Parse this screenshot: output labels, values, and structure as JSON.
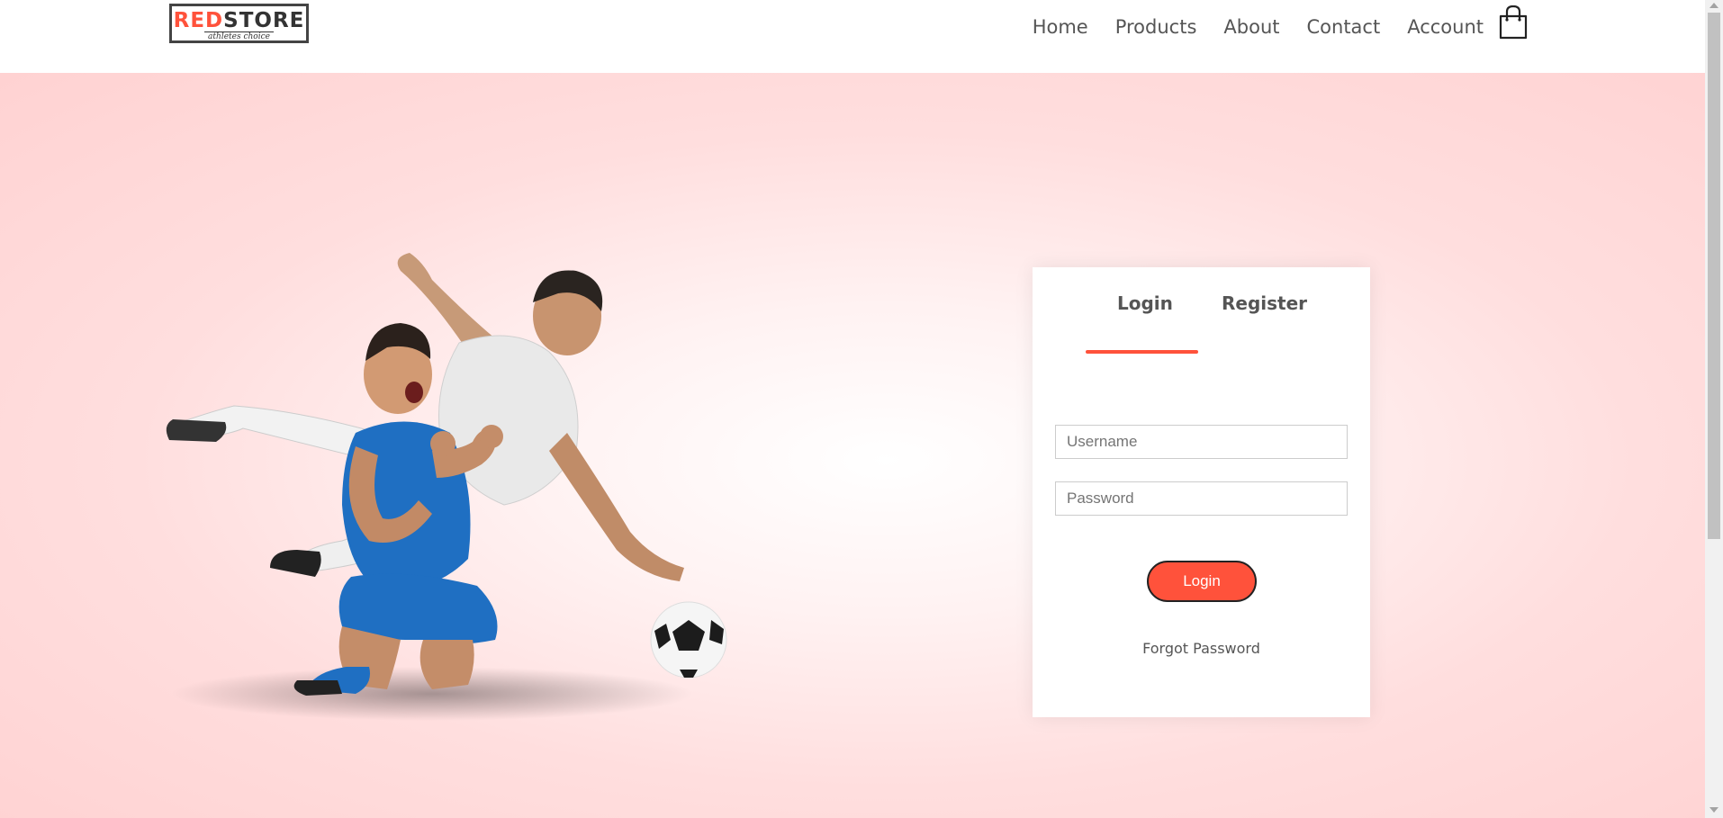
{
  "brand": {
    "logo_part1": "RED",
    "logo_part2": "STORE",
    "tagline": "athletes choice"
  },
  "nav": {
    "items": [
      {
        "label": "Home"
      },
      {
        "label": "Products"
      },
      {
        "label": "About"
      },
      {
        "label": "Contact"
      },
      {
        "label": "Account"
      }
    ],
    "cart_icon": "shopping-bag-icon"
  },
  "form": {
    "tabs": [
      {
        "label": "Login"
      },
      {
        "label": "Register"
      }
    ],
    "active_tab": "Login",
    "username": {
      "placeholder": "Username",
      "value": ""
    },
    "password": {
      "placeholder": "Password",
      "value": ""
    },
    "submit_label": "Login",
    "forgot_label": "Forgot Password"
  },
  "colors": {
    "accent": "#ff523b",
    "hero_bg": "#ffd6d6",
    "text": "#555555"
  }
}
